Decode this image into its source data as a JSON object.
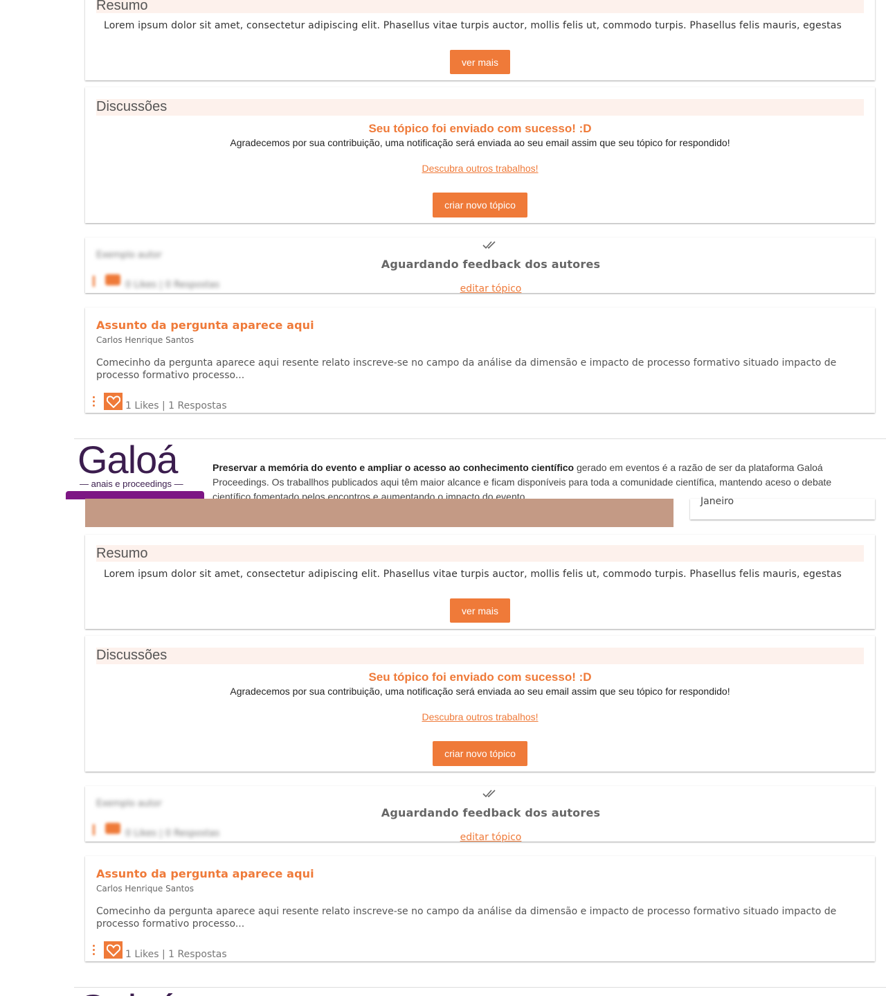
{
  "colors": {
    "accent": "#ef7a39",
    "brand_purple": "#3b1d4e",
    "bar_purple": "#7d1684",
    "section_bg": "#fdf1ec",
    "image_placeholder": "#c49a85"
  },
  "summary": {
    "title": "Resumo",
    "text": "Lorem ipsum dolor sit amet, consectetur adipiscing elit. Phasellus vitae turpis auctor, mollis felis ut, commodo turpis. Phasellus felis mauris, egestas",
    "more_button": "ver mais"
  },
  "discussions": {
    "title": "Discussões",
    "success_title": "Seu tópico foi enviado com sucesso! :D",
    "success_text": "Agradecemos por sua contribuição, uma notificação será enviada ao seu email assim que seu tópico for respondido!",
    "discover_link": "Descubra outros trabalhos!",
    "new_topic_button": "criar novo tópico"
  },
  "pending": {
    "blur_author": "Exemplo autor",
    "blur_stats": "0 Likes | 0 Respostas",
    "status": "Aguardando feedback dos autores",
    "edit_link": "editar tópico",
    "icon": "double-check-icon"
  },
  "question": {
    "title": "Assunto da pergunta aparece aqui",
    "author": "Carlos Henrique Santos",
    "body": "Comecinho da pergunta aparece aqui resente relato inscreve-se no campo da análise da dimensão e impacto de processo formativo situado impacto de processo formativo processo...",
    "stats": "1 Likes | 1 Respostas",
    "menu_icon": "kebab-menu-icon",
    "like_icon": "heart-icon"
  },
  "footer": {
    "logo_word": "Galoá",
    "logo_sub": "— anais e proceedings —",
    "text_bold": "Preservar a memória do evento e ampliar o acesso ao conhecimento científico",
    "text_rest": " gerado em eventos é a razão de ser da plataforma Galoá Proceedings. Os traballhos publicados aqui têm maior alcance e ficam disponíveis para toda a comunidade científica, mantendo aceso o debate científico fomentado pelos encontros e aumentando o impacto do evento."
  },
  "sidebar_card": {
    "text": "Janeiro"
  }
}
